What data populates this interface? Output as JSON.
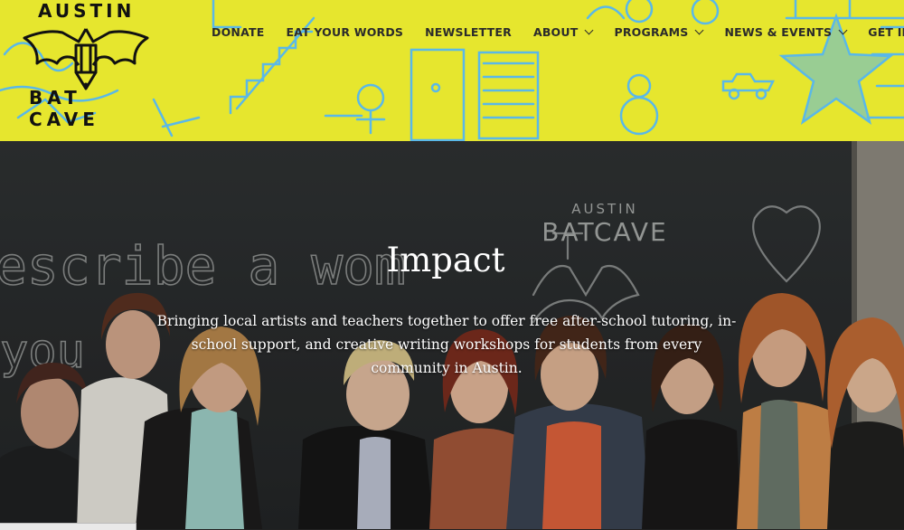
{
  "header": {
    "logo": {
      "line1": "AUSTIN",
      "line2": "BAT CAVE"
    },
    "nav": [
      {
        "label": "DONATE",
        "has_dropdown": false
      },
      {
        "label": "EAT YOUR WORDS",
        "has_dropdown": false
      },
      {
        "label": "NEWSLETTER",
        "has_dropdown": false
      },
      {
        "label": "ABOUT",
        "has_dropdown": true
      },
      {
        "label": "PROGRAMS",
        "has_dropdown": true
      },
      {
        "label": "NEWS & EVENTS",
        "has_dropdown": true
      },
      {
        "label": "GET INVOLVED",
        "has_dropdown": true
      }
    ],
    "background_color": "#e6e62e",
    "doodle_color": "#5ab8e8"
  },
  "hero": {
    "title": "Impact",
    "body": "Bringing local artists and teachers together to offer free after-school tutoring, in-school support, and creative writing workshops for students from every community in Austin.",
    "chalkboard_text": "escribe a wom",
    "chalkboard_text2": "you",
    "chalkboard_logo_line1": "AUSTIN",
    "chalkboard_logo_line2": "BATCAVE"
  }
}
